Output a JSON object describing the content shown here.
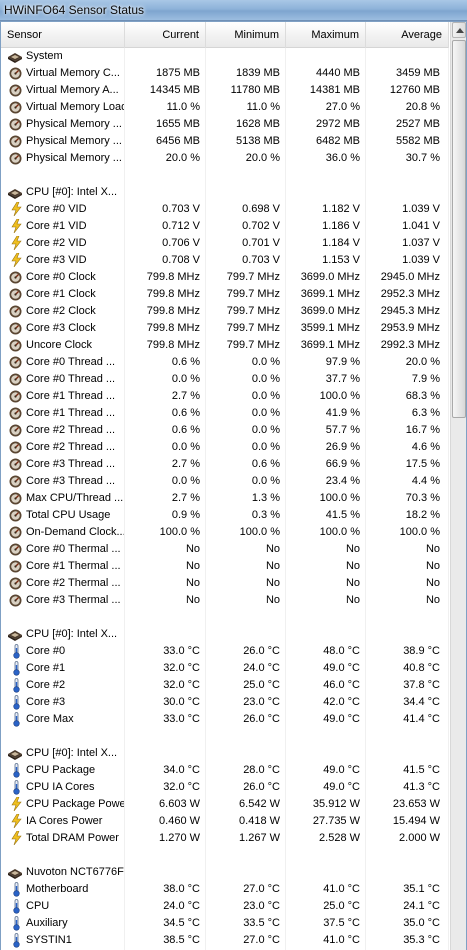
{
  "window": {
    "title": "HWiNFO64 Sensor Status"
  },
  "columns": {
    "sensor": "Sensor",
    "current": "Current",
    "minimum": "Minimum",
    "maximum": "Maximum",
    "average": "Average"
  },
  "colors": {
    "temp": "#2a63c7",
    "volt": "#e3b21c",
    "gauge": "#6b4a2a"
  },
  "rows": [
    {
      "type": "group",
      "icon": "chip-icon",
      "name": "System"
    },
    {
      "type": "sensor",
      "icon": "gauge-icon",
      "name": "Virtual Memory C...",
      "cur": "1875 MB",
      "min": "1839 MB",
      "max": "4440 MB",
      "avg": "3459 MB"
    },
    {
      "type": "sensor",
      "icon": "gauge-icon",
      "name": "Virtual Memory A...",
      "cur": "14345 MB",
      "min": "11780 MB",
      "max": "14381 MB",
      "avg": "12760 MB"
    },
    {
      "type": "sensor",
      "icon": "gauge-icon",
      "name": "Virtual Memory Load",
      "cur": "11.0 %",
      "min": "11.0 %",
      "max": "27.0 %",
      "avg": "20.8 %"
    },
    {
      "type": "sensor",
      "icon": "gauge-icon",
      "name": "Physical Memory ...",
      "cur": "1655 MB",
      "min": "1628 MB",
      "max": "2972 MB",
      "avg": "2527 MB"
    },
    {
      "type": "sensor",
      "icon": "gauge-icon",
      "name": "Physical Memory ...",
      "cur": "6456 MB",
      "min": "5138 MB",
      "max": "6482 MB",
      "avg": "5582 MB"
    },
    {
      "type": "sensor",
      "icon": "gauge-icon",
      "name": "Physical Memory ...",
      "cur": "20.0 %",
      "min": "20.0 %",
      "max": "36.0 %",
      "avg": "30.7 %"
    },
    {
      "type": "blank"
    },
    {
      "type": "group",
      "icon": "chip-icon",
      "name": "CPU [#0]: Intel X..."
    },
    {
      "type": "sensor",
      "icon": "volt-icon",
      "name": "Core #0 VID",
      "cur": "0.703 V",
      "min": "0.698 V",
      "max": "1.182 V",
      "avg": "1.039 V"
    },
    {
      "type": "sensor",
      "icon": "volt-icon",
      "name": "Core #1 VID",
      "cur": "0.712 V",
      "min": "0.702 V",
      "max": "1.186 V",
      "avg": "1.041 V"
    },
    {
      "type": "sensor",
      "icon": "volt-icon",
      "name": "Core #2 VID",
      "cur": "0.706 V",
      "min": "0.701 V",
      "max": "1.184 V",
      "avg": "1.037 V"
    },
    {
      "type": "sensor",
      "icon": "volt-icon",
      "name": "Core #3 VID",
      "cur": "0.708 V",
      "min": "0.703 V",
      "max": "1.153 V",
      "avg": "1.039 V"
    },
    {
      "type": "sensor",
      "icon": "gauge-icon",
      "name": "Core #0 Clock",
      "cur": "799.8 MHz",
      "min": "799.7 MHz",
      "max": "3699.0 MHz",
      "avg": "2945.0 MHz"
    },
    {
      "type": "sensor",
      "icon": "gauge-icon",
      "name": "Core #1 Clock",
      "cur": "799.8 MHz",
      "min": "799.7 MHz",
      "max": "3699.1 MHz",
      "avg": "2952.3 MHz"
    },
    {
      "type": "sensor",
      "icon": "gauge-icon",
      "name": "Core #2 Clock",
      "cur": "799.8 MHz",
      "min": "799.7 MHz",
      "max": "3699.0 MHz",
      "avg": "2945.3 MHz"
    },
    {
      "type": "sensor",
      "icon": "gauge-icon",
      "name": "Core #3 Clock",
      "cur": "799.8 MHz",
      "min": "799.7 MHz",
      "max": "3599.1 MHz",
      "avg": "2953.9 MHz"
    },
    {
      "type": "sensor",
      "icon": "gauge-icon",
      "name": "Uncore Clock",
      "cur": "799.8 MHz",
      "min": "799.7 MHz",
      "max": "3699.1 MHz",
      "avg": "2992.3 MHz"
    },
    {
      "type": "sensor",
      "icon": "gauge-icon",
      "name": "Core #0 Thread ...",
      "cur": "0.6 %",
      "min": "0.0 %",
      "max": "97.9 %",
      "avg": "20.0 %"
    },
    {
      "type": "sensor",
      "icon": "gauge-icon",
      "name": "Core #0 Thread ...",
      "cur": "0.0 %",
      "min": "0.0 %",
      "max": "37.7 %",
      "avg": "7.9 %"
    },
    {
      "type": "sensor",
      "icon": "gauge-icon",
      "name": "Core #1 Thread ...",
      "cur": "2.7 %",
      "min": "0.0 %",
      "max": "100.0 %",
      "avg": "68.3 %"
    },
    {
      "type": "sensor",
      "icon": "gauge-icon",
      "name": "Core #1 Thread ...",
      "cur": "0.6 %",
      "min": "0.0 %",
      "max": "41.9 %",
      "avg": "6.3 %"
    },
    {
      "type": "sensor",
      "icon": "gauge-icon",
      "name": "Core #2 Thread ...",
      "cur": "0.6 %",
      "min": "0.0 %",
      "max": "57.7 %",
      "avg": "16.7 %"
    },
    {
      "type": "sensor",
      "icon": "gauge-icon",
      "name": "Core #2 Thread ...",
      "cur": "0.0 %",
      "min": "0.0 %",
      "max": "26.9 %",
      "avg": "4.6 %"
    },
    {
      "type": "sensor",
      "icon": "gauge-icon",
      "name": "Core #3 Thread ...",
      "cur": "2.7 %",
      "min": "0.6 %",
      "max": "66.9 %",
      "avg": "17.5 %"
    },
    {
      "type": "sensor",
      "icon": "gauge-icon",
      "name": "Core #3 Thread ...",
      "cur": "0.0 %",
      "min": "0.0 %",
      "max": "23.4 %",
      "avg": "4.4 %"
    },
    {
      "type": "sensor",
      "icon": "gauge-icon",
      "name": "Max CPU/Thread ...",
      "cur": "2.7 %",
      "min": "1.3 %",
      "max": "100.0 %",
      "avg": "70.3 %"
    },
    {
      "type": "sensor",
      "icon": "gauge-icon",
      "name": "Total CPU Usage",
      "cur": "0.9 %",
      "min": "0.3 %",
      "max": "41.5 %",
      "avg": "18.2 %"
    },
    {
      "type": "sensor",
      "icon": "gauge-icon",
      "name": "On-Demand Clock...",
      "cur": "100.0 %",
      "min": "100.0 %",
      "max": "100.0 %",
      "avg": "100.0 %"
    },
    {
      "type": "sensor",
      "icon": "gauge-icon",
      "name": "Core #0 Thermal ...",
      "cur": "No",
      "min": "No",
      "max": "No",
      "avg": "No"
    },
    {
      "type": "sensor",
      "icon": "gauge-icon",
      "name": "Core #1 Thermal ...",
      "cur": "No",
      "min": "No",
      "max": "No",
      "avg": "No"
    },
    {
      "type": "sensor",
      "icon": "gauge-icon",
      "name": "Core #2 Thermal ...",
      "cur": "No",
      "min": "No",
      "max": "No",
      "avg": "No"
    },
    {
      "type": "sensor",
      "icon": "gauge-icon",
      "name": "Core #3 Thermal ...",
      "cur": "No",
      "min": "No",
      "max": "No",
      "avg": "No"
    },
    {
      "type": "blank"
    },
    {
      "type": "group",
      "icon": "chip-icon",
      "name": "CPU [#0]: Intel X..."
    },
    {
      "type": "sensor",
      "icon": "thermometer-icon",
      "name": "Core #0",
      "cur": "33.0 °C",
      "min": "26.0 °C",
      "max": "48.0 °C",
      "avg": "38.9 °C"
    },
    {
      "type": "sensor",
      "icon": "thermometer-icon",
      "name": "Core #1",
      "cur": "32.0 °C",
      "min": "24.0 °C",
      "max": "49.0 °C",
      "avg": "40.8 °C"
    },
    {
      "type": "sensor",
      "icon": "thermometer-icon",
      "name": "Core #2",
      "cur": "32.0 °C",
      "min": "25.0 °C",
      "max": "46.0 °C",
      "avg": "37.8 °C"
    },
    {
      "type": "sensor",
      "icon": "thermometer-icon",
      "name": "Core #3",
      "cur": "30.0 °C",
      "min": "23.0 °C",
      "max": "42.0 °C",
      "avg": "34.4 °C"
    },
    {
      "type": "sensor",
      "icon": "thermometer-icon",
      "name": "Core Max",
      "cur": "33.0 °C",
      "min": "26.0 °C",
      "max": "49.0 °C",
      "avg": "41.4 °C"
    },
    {
      "type": "blank"
    },
    {
      "type": "group",
      "icon": "chip-icon",
      "name": "CPU [#0]: Intel X..."
    },
    {
      "type": "sensor",
      "icon": "thermometer-icon",
      "name": "CPU Package",
      "cur": "34.0 °C",
      "min": "28.0 °C",
      "max": "49.0 °C",
      "avg": "41.5 °C"
    },
    {
      "type": "sensor",
      "icon": "thermometer-icon",
      "name": "CPU IA Cores",
      "cur": "32.0 °C",
      "min": "26.0 °C",
      "max": "49.0 °C",
      "avg": "41.3 °C"
    },
    {
      "type": "sensor",
      "icon": "volt-icon",
      "name": "CPU Package Power",
      "cur": "6.603 W",
      "min": "6.542 W",
      "max": "35.912 W",
      "avg": "23.653 W"
    },
    {
      "type": "sensor",
      "icon": "volt-icon",
      "name": "IA Cores Power",
      "cur": "0.460 W",
      "min": "0.418 W",
      "max": "27.735 W",
      "avg": "15.494 W"
    },
    {
      "type": "sensor",
      "icon": "volt-icon",
      "name": "Total DRAM Power",
      "cur": "1.270 W",
      "min": "1.267 W",
      "max": "2.528 W",
      "avg": "2.000 W"
    },
    {
      "type": "blank"
    },
    {
      "type": "group",
      "icon": "chip-icon",
      "name": "Nuvoton NCT6776F"
    },
    {
      "type": "sensor",
      "icon": "thermometer-icon",
      "name": "Motherboard",
      "cur": "38.0 °C",
      "min": "27.0 °C",
      "max": "41.0 °C",
      "avg": "35.1 °C"
    },
    {
      "type": "sensor",
      "icon": "thermometer-icon",
      "name": "CPU",
      "cur": "24.0 °C",
      "min": "23.0 °C",
      "max": "25.0 °C",
      "avg": "24.1 °C"
    },
    {
      "type": "sensor",
      "icon": "thermometer-icon",
      "name": "Auxiliary",
      "cur": "34.5 °C",
      "min": "33.5 °C",
      "max": "37.5 °C",
      "avg": "35.0 °C"
    },
    {
      "type": "sensor",
      "icon": "thermometer-icon",
      "name": "SYSTIN1",
      "cur": "38.5 °C",
      "min": "27.0 °C",
      "max": "41.0 °C",
      "avg": "35.3 °C"
    }
  ]
}
